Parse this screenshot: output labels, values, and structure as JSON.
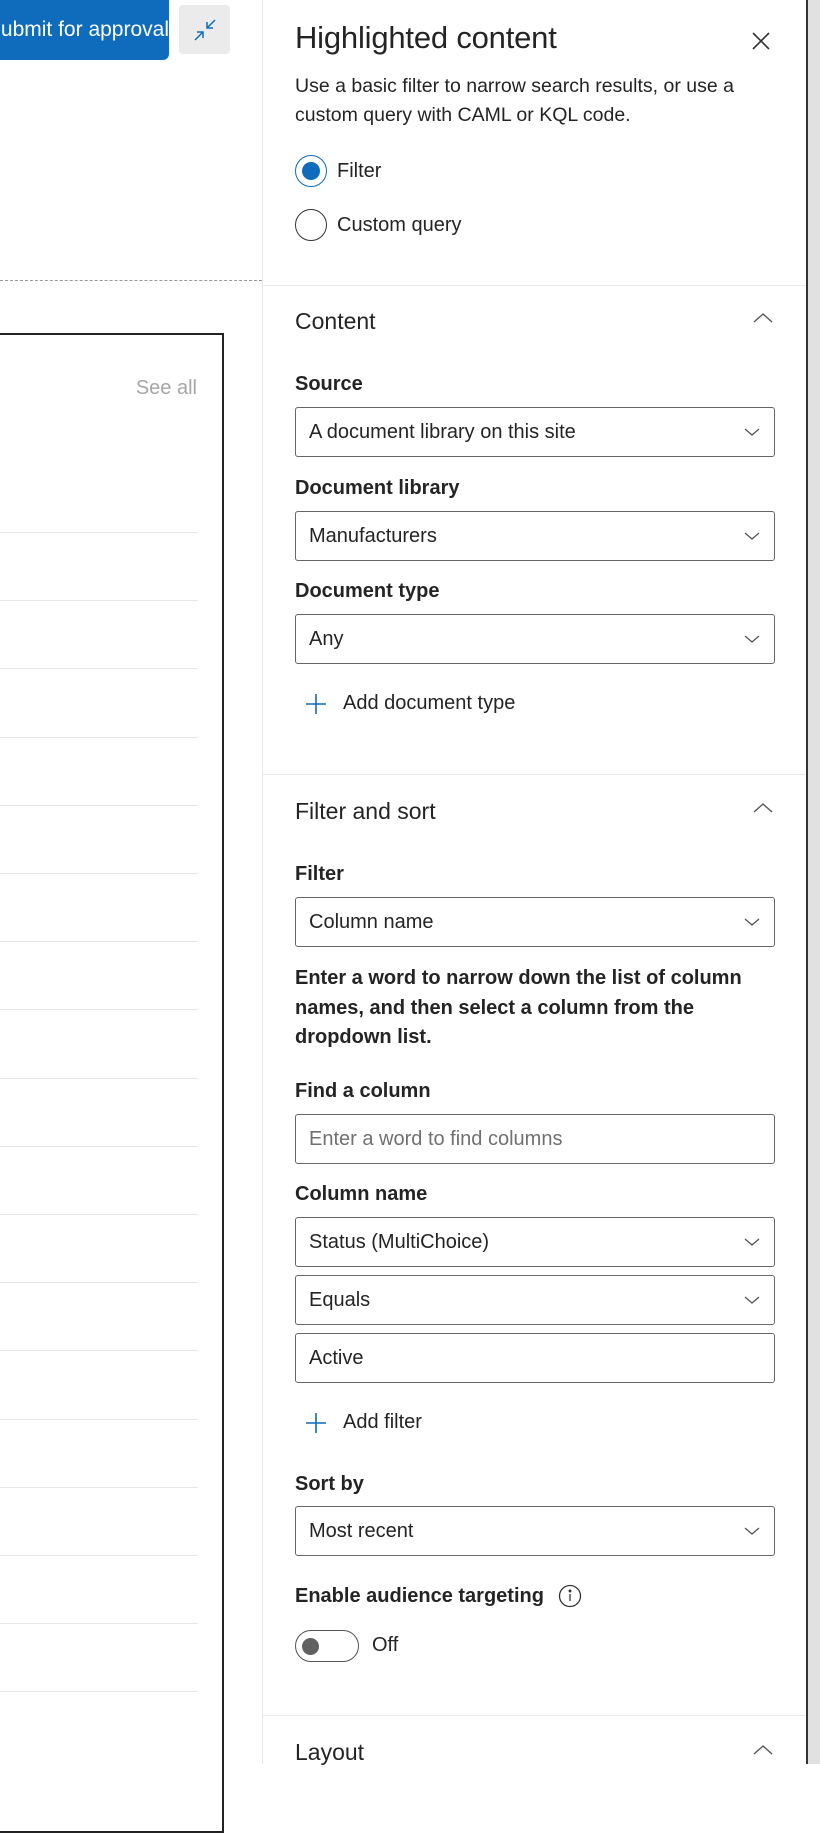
{
  "background": {
    "submit_button": "Submit for approval",
    "collapse_icon": "collapse-arrows-icon",
    "see_all": "See all"
  },
  "panel": {
    "title": "Highlighted content",
    "close_icon": "close-icon",
    "description": "Use a basic filter to narrow search results, or use a custom query with CAML or KQL code.",
    "mode_options": [
      {
        "label": "Filter",
        "selected": true
      },
      {
        "label": "Custom query",
        "selected": false
      }
    ],
    "content": {
      "heading": "Content",
      "source_label": "Source",
      "source_value": "A document library on this site",
      "library_label": "Document library",
      "library_value": "Manufacturers",
      "doctype_label": "Document type",
      "doctype_value": "Any",
      "add_doctype": "Add document type"
    },
    "filter_sort": {
      "heading": "Filter and sort",
      "filter_label": "Filter",
      "filter_value": "Column name",
      "help": "Enter a word to narrow down the list of column names, and then select a column from the dropdown list.",
      "find_label": "Find a column",
      "find_placeholder": "Enter a word to find columns",
      "column_label": "Column name",
      "column_value": "Status (MultiChoice)",
      "operator_value": "Equals",
      "filter_text": "Active",
      "add_filter": "Add filter",
      "sort_label": "Sort by",
      "sort_value": "Most recent",
      "audience_label": "Enable audience targeting",
      "audience_state": "Off"
    },
    "layout": {
      "heading": "Layout"
    }
  },
  "colors": {
    "accent": "#0f6cbd",
    "text": "#242424"
  }
}
